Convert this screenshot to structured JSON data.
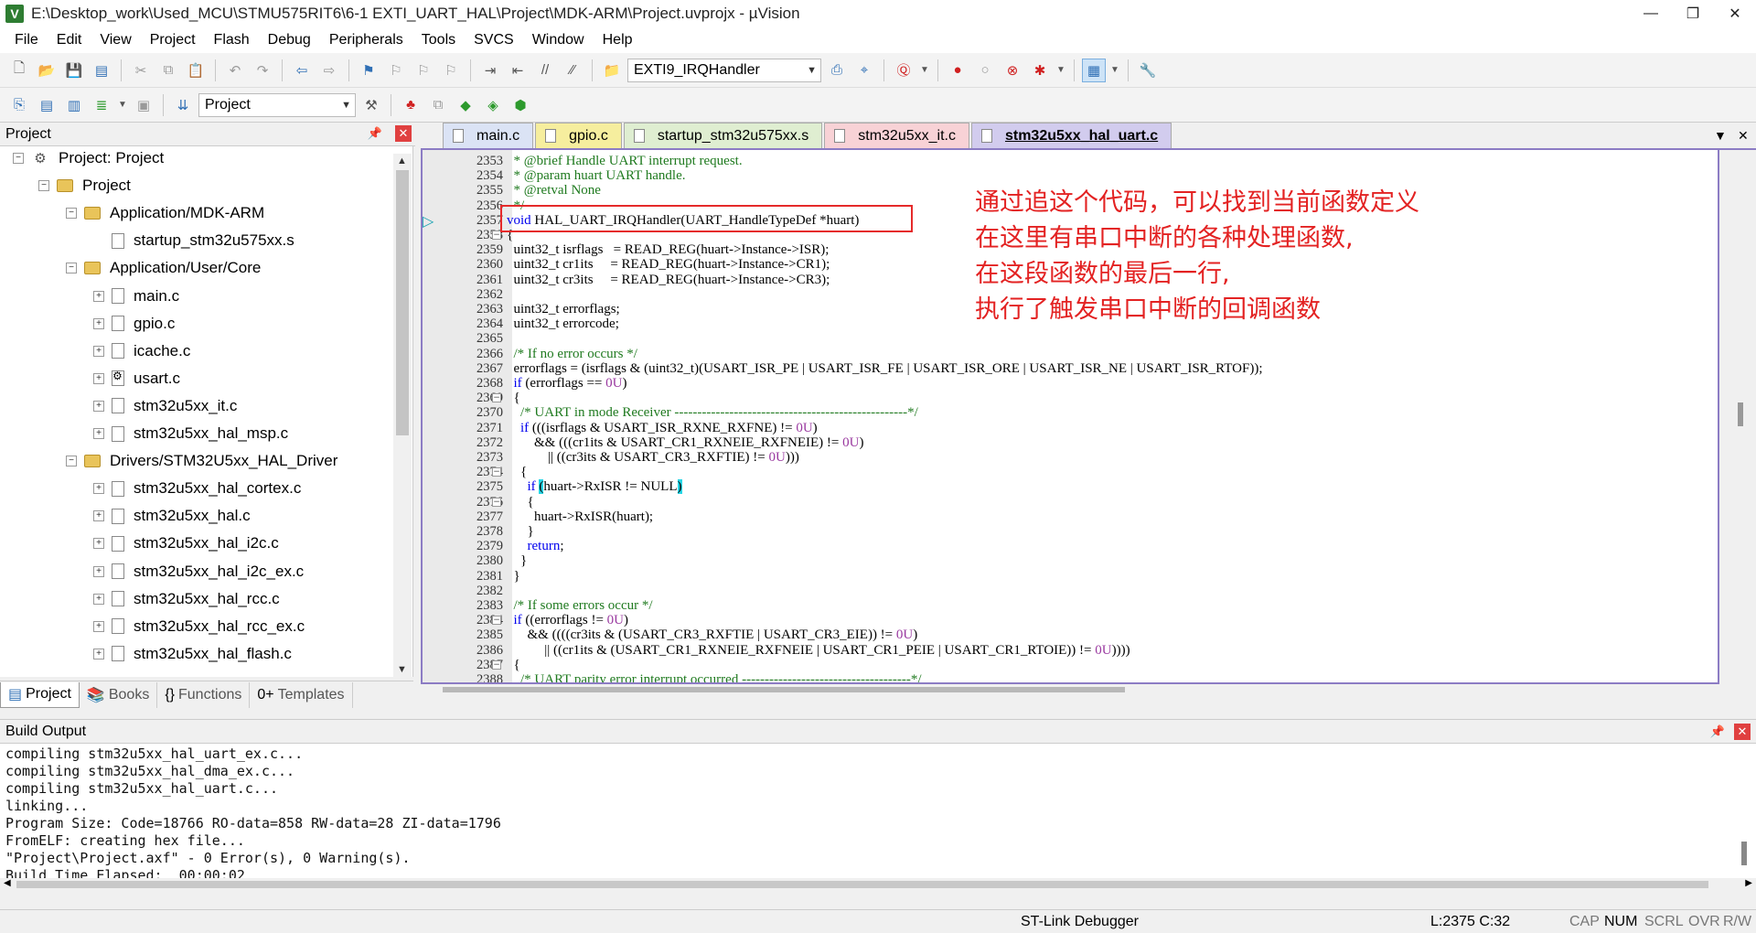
{
  "window": {
    "title": "E:\\Desktop_work\\Used_MCU\\STMU575RIT6\\6-1 EXTI_UART_HAL\\Project\\MDK-ARM\\Project.uvprojx - µVision",
    "minimize": "—",
    "restore": "❐",
    "close": "✕"
  },
  "menu": [
    "File",
    "Edit",
    "View",
    "Project",
    "Flash",
    "Debug",
    "Peripherals",
    "Tools",
    "SVCS",
    "Window",
    "Help"
  ],
  "toolbar": {
    "function_combo": "EXTI9_IRQHandler",
    "target_combo": "Project"
  },
  "project_panel": {
    "title": "Project",
    "tree": [
      {
        "label": "Project: Project",
        "level": 0,
        "type": "root",
        "exp": "−"
      },
      {
        "label": "Project",
        "level": 1,
        "type": "folder",
        "exp": "−"
      },
      {
        "label": "Application/MDK-ARM",
        "level": 2,
        "type": "folder",
        "exp": "−"
      },
      {
        "label": "startup_stm32u575xx.s",
        "level": 3,
        "type": "file",
        "exp": ""
      },
      {
        "label": "Application/User/Core",
        "level": 2,
        "type": "folder",
        "exp": "−"
      },
      {
        "label": "main.c",
        "level": 3,
        "type": "file",
        "exp": "+"
      },
      {
        "label": "gpio.c",
        "level": 3,
        "type": "file",
        "exp": "+"
      },
      {
        "label": "icache.c",
        "level": 3,
        "type": "file",
        "exp": "+"
      },
      {
        "label": "usart.c",
        "level": 3,
        "type": "gearfile",
        "exp": "+"
      },
      {
        "label": "stm32u5xx_it.c",
        "level": 3,
        "type": "file",
        "exp": "+"
      },
      {
        "label": "stm32u5xx_hal_msp.c",
        "level": 3,
        "type": "file",
        "exp": "+"
      },
      {
        "label": "Drivers/STM32U5xx_HAL_Driver",
        "level": 2,
        "type": "folder",
        "exp": "−"
      },
      {
        "label": "stm32u5xx_hal_cortex.c",
        "level": 3,
        "type": "file",
        "exp": "+"
      },
      {
        "label": "stm32u5xx_hal.c",
        "level": 3,
        "type": "file",
        "exp": "+"
      },
      {
        "label": "stm32u5xx_hal_i2c.c",
        "level": 3,
        "type": "file",
        "exp": "+"
      },
      {
        "label": "stm32u5xx_hal_i2c_ex.c",
        "level": 3,
        "type": "file",
        "exp": "+"
      },
      {
        "label": "stm32u5xx_hal_rcc.c",
        "level": 3,
        "type": "file",
        "exp": "+"
      },
      {
        "label": "stm32u5xx_hal_rcc_ex.c",
        "level": 3,
        "type": "file",
        "exp": "+"
      },
      {
        "label": "stm32u5xx_hal_flash.c",
        "level": 3,
        "type": "file",
        "exp": "+"
      }
    ],
    "tabs": [
      "Project",
      "Books",
      "Functions",
      "Templates"
    ]
  },
  "editor": {
    "tabs": [
      "main.c",
      "gpio.c",
      "startup_stm32u575xx.s",
      "stm32u5xx_it.c",
      "stm32u5xx_hal_uart.c"
    ],
    "active_tab": "stm32u5xx_hal_uart.c",
    "lines": [
      {
        "n": "2353",
        "t": "  * @brief Handle UART interrupt request.",
        "k": "com"
      },
      {
        "n": "2354",
        "t": "  * @param huart UART handle.",
        "k": "com"
      },
      {
        "n": "2355",
        "t": "  * @retval None",
        "k": "com"
      },
      {
        "n": "2356",
        "t": "  */",
        "k": "com"
      },
      {
        "n": "2357",
        "t": "void HAL_UART_IRQHandler(UART_HandleTypeDef *huart)",
        "k": "fn"
      },
      {
        "n": "2358",
        "t": "{",
        "k": "",
        "f": "−"
      },
      {
        "n": "2359",
        "t": "  uint32_t isrflags   = READ_REG(huart->Instance->ISR);",
        "k": ""
      },
      {
        "n": "2360",
        "t": "  uint32_t cr1its     = READ_REG(huart->Instance->CR1);",
        "k": ""
      },
      {
        "n": "2361",
        "t": "  uint32_t cr3its     = READ_REG(huart->Instance->CR3);",
        "k": ""
      },
      {
        "n": "2362",
        "t": "",
        "k": ""
      },
      {
        "n": "2363",
        "t": "  uint32_t errorflags;",
        "k": ""
      },
      {
        "n": "2364",
        "t": "  uint32_t errorcode;",
        "k": ""
      },
      {
        "n": "2365",
        "t": "",
        "k": ""
      },
      {
        "n": "2366",
        "t": "  /* If no error occurs */",
        "k": "com"
      },
      {
        "n": "2367",
        "t": "  errorflags = (isrflags & (uint32_t)(USART_ISR_PE | USART_ISR_FE | USART_ISR_ORE | USART_ISR_NE | USART_ISR_RTOF));",
        "k": ""
      },
      {
        "n": "2368",
        "t": "  if (errorflags == 0U)",
        "k": "if"
      },
      {
        "n": "2369",
        "t": "  {",
        "k": "",
        "f": "−"
      },
      {
        "n": "2370",
        "t": "    /* UART in mode Receiver ---------------------------------------------------*/",
        "k": "com"
      },
      {
        "n": "2371",
        "t": "    if (((isrflags & USART_ISR_RXNE_RXFNE) != 0U)",
        "k": "if"
      },
      {
        "n": "2372",
        "t": "        && (((cr1its & USART_CR1_RXNEIE_RXFNEIE) != 0U)",
        "k": ""
      },
      {
        "n": "2373",
        "t": "            || ((cr3its & USART_CR3_RXFTIE) != 0U)))",
        "k": ""
      },
      {
        "n": "2374",
        "t": "    {",
        "k": "",
        "f": "−"
      },
      {
        "n": "2375",
        "t": "      if (huart->RxISR != NULL)",
        "k": "hl"
      },
      {
        "n": "2376",
        "t": "      {",
        "k": "",
        "f": "−"
      },
      {
        "n": "2377",
        "t": "        huart->RxISR(huart);",
        "k": ""
      },
      {
        "n": "2378",
        "t": "      }",
        "k": ""
      },
      {
        "n": "2379",
        "t": "      return;",
        "k": "ret"
      },
      {
        "n": "2380",
        "t": "    }",
        "k": ""
      },
      {
        "n": "2381",
        "t": "  }",
        "k": ""
      },
      {
        "n": "2382",
        "t": "",
        "k": ""
      },
      {
        "n": "2383",
        "t": "  /* If some errors occur */",
        "k": "com"
      },
      {
        "n": "2384",
        "t": "  if ((errorflags != 0U)",
        "k": "if",
        "f": "−"
      },
      {
        "n": "2385",
        "t": "      && ((((cr3its & (USART_CR3_RXFTIE | USART_CR3_EIE)) != 0U)",
        "k": ""
      },
      {
        "n": "2386",
        "t": "           || ((cr1its & (USART_CR1_RXNEIE_RXFNEIE | USART_CR1_PEIE | USART_CR1_RTOIE)) != 0U))))",
        "k": ""
      },
      {
        "n": "2387",
        "t": "  {",
        "k": "",
        "f": "−"
      },
      {
        "n": "2388",
        "t": "    /* UART parity error interrupt occurred -------------------------------------*/",
        "k": "com"
      }
    ]
  },
  "annotation": [
    "通过追这个代码，可以找到当前函数定义",
    "在这里有串口中断的各种处理函数,",
    "在这段函数的最后一行,",
    "执行了触发串口中断的回调函数"
  ],
  "build": {
    "title": "Build Output",
    "lines": [
      "compiling stm32u5xx_hal_uart_ex.c...",
      "compiling stm32u5xx_hal_dma_ex.c...",
      "compiling stm32u5xx_hal_uart.c...",
      "linking...",
      "Program Size: Code=18766 RO-data=858 RW-data=28 ZI-data=1796",
      "FromELF: creating hex file...",
      "\"Project\\Project.axf\" - 0 Error(s), 0 Warning(s).",
      "Build Time Elapsed:  00:00:02"
    ]
  },
  "status": {
    "debugger": "ST-Link Debugger",
    "position": "L:2375 C:32",
    "cap": "CAP",
    "num": "NUM",
    "scrl": "SCRL",
    "ovr": "OVR",
    "rw": "R/W"
  },
  "colors": {
    "comment": "#1f7a1f",
    "keyword": "#0000ee",
    "annotation": "#e32222",
    "frame": "#8c7cc4"
  }
}
